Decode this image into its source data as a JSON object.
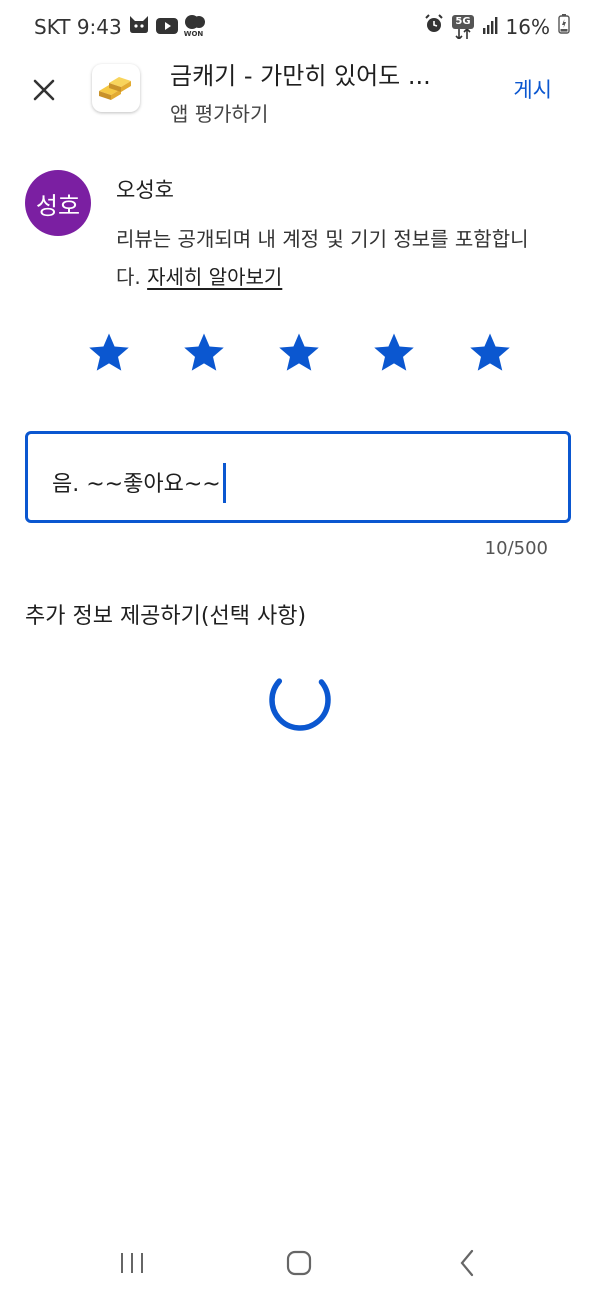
{
  "status_bar": {
    "carrier_time": "SKT 9:43",
    "left_icons": [
      "cat-icon",
      "youtube-icon",
      "won-chat-icon"
    ],
    "won_label": "WON",
    "network_label": "5G",
    "battery": "16%",
    "right_icons": [
      "alarm-icon",
      "data-transfer-icon",
      "signal-icon",
      "battery-icon"
    ]
  },
  "header": {
    "close_icon": "close-icon",
    "app_icon": "gold-bars-icon",
    "app_title": "금캐기 - 가만히 있어도 ...",
    "subtitle": "앱 평가하기",
    "post_label": "게시"
  },
  "user": {
    "avatar_text": "성호",
    "avatar_color": "#7b1fa2",
    "name": "오성호",
    "notice_text": "리뷰는 공개되며 내 계정 및 기기 정보를 포함합니다. ",
    "learn_more": "자세히 알아보기"
  },
  "rating": {
    "selected": 5,
    "max": 5,
    "star_color": "#0b57d0"
  },
  "review": {
    "value": "음. ~~좋아요~~",
    "counter": "10/500"
  },
  "extra_info": {
    "title": "추가 정보 제공하기(선택 사항)"
  },
  "colors": {
    "accent": "#0b57d0"
  },
  "nav_bar": {
    "icons": [
      "recent-apps-icon",
      "home-icon",
      "back-icon"
    ]
  }
}
